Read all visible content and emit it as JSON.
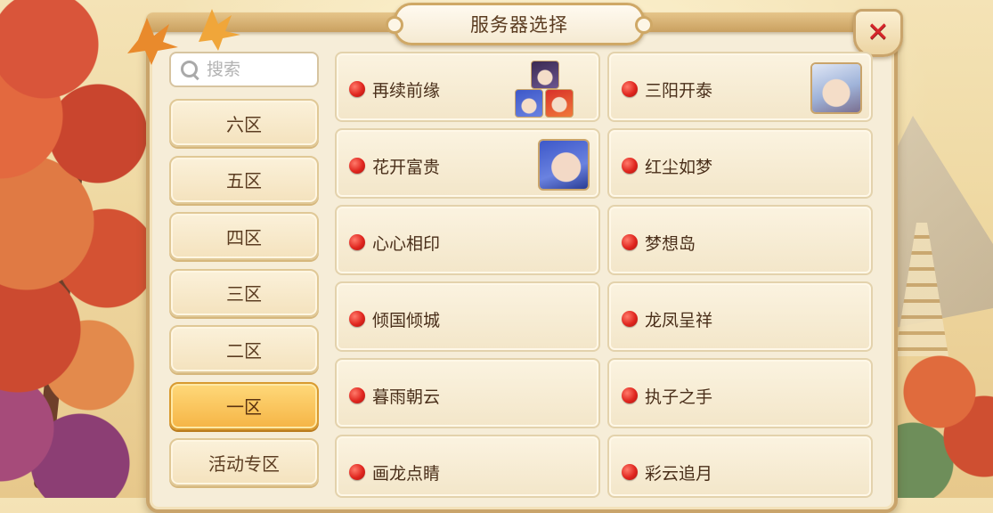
{
  "title": "服务器选择",
  "close_icon": "close-x-icon",
  "search": {
    "placeholder": "搜索",
    "value": ""
  },
  "zones": [
    {
      "label": "六区",
      "active": false
    },
    {
      "label": "五区",
      "active": false
    },
    {
      "label": "四区",
      "active": false
    },
    {
      "label": "三区",
      "active": false
    },
    {
      "label": "二区",
      "active": false
    },
    {
      "label": "一区",
      "active": true
    },
    {
      "label": "活动专区",
      "active": false
    }
  ],
  "servers": [
    {
      "name": "再续前缘",
      "status": "red",
      "avatar": "three-character-avatars"
    },
    {
      "name": "三阳开泰",
      "status": "red",
      "avatar": "white-haired-character-avatar"
    },
    {
      "name": "花开富贵",
      "status": "red",
      "avatar": "blue-haired-character-avatar"
    },
    {
      "name": "红尘如梦",
      "status": "red",
      "avatar": ""
    },
    {
      "name": "心心相印",
      "status": "red",
      "avatar": ""
    },
    {
      "name": "梦想岛",
      "status": "red",
      "avatar": ""
    },
    {
      "name": "倾国倾城",
      "status": "red",
      "avatar": ""
    },
    {
      "name": "龙凤呈祥",
      "status": "red",
      "avatar": ""
    },
    {
      "name": "暮雨朝云",
      "status": "red",
      "avatar": ""
    },
    {
      "name": "执子之手",
      "status": "red",
      "avatar": ""
    },
    {
      "name": "画龙点睛",
      "status": "red",
      "avatar": ""
    },
    {
      "name": "彩云追月",
      "status": "red",
      "avatar": ""
    }
  ],
  "colors": {
    "status_red": "#e0261f",
    "active_zone": "#f5b445",
    "panel": "#f6edd8",
    "border_gold": "#c9a46b"
  }
}
